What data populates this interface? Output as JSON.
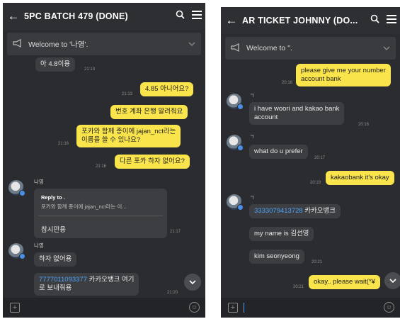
{
  "left": {
    "title": "5PC BATCH 479 (DONE)",
    "notice": "Welcome to '나영'.",
    "messages": {
      "m1": "아 4.8이용",
      "m1_time": "21:13",
      "m2": "4.85 아니어요?",
      "m2_time": "21:13",
      "m3": "번호 계좌 은행 알려줘요",
      "m4_line1": "포카와 함께 종이에 jajan_nct라는",
      "m4_line2": "이름을 쓸 수 있나요?",
      "m4_time": "21:16",
      "m5": "다른 포카 하자 없어요?",
      "m5_time": "21:16",
      "sender1": "나영",
      "reply_to": "Reply to .",
      "reply_quote": "포카와 함께 종이에 jajan_nct라는 이...",
      "reply_msg": "참시만용",
      "reply_time": "21:17",
      "sender2": "나영",
      "m6": "하자 없어용",
      "m7_account": "7777011093377",
      "m7_rest": " 카카오뱅크 여기",
      "m7_line2": "로 보내줘용",
      "m7_time": "21:20"
    }
  },
  "right": {
    "title": "AR TICKET JOHNNY (DO...",
    "notice": "Welcome to ''.",
    "messages": {
      "m1_line1": "please give me your number",
      "m1_line2": "account bank",
      "m1_time": "20:16",
      "sender1": "\"!",
      "m2_line1": "i have woori and kakao bank",
      "m2_line2": "account",
      "m2_time": "20:16",
      "sender2": "\"!",
      "m3": "what do u prefer",
      "m3_time": "20:17",
      "m4": "kakaobank it's okay",
      "m4_time": "20:19",
      "sender3": "\"!",
      "m5_account": "3333079413728",
      "m5_rest": " 카카오뱅크",
      "m6": "my name is 김선영",
      "m7": "kim seonyeong",
      "m7_time": "20:21",
      "m8": "okay.. please wait(*¥",
      "m8_time": "20:21"
    }
  },
  "icons": {
    "back": "←",
    "search": "⌕",
    "menu": "☰",
    "speaker": "📢",
    "chevron_down": "⌄",
    "plus": "+",
    "emoji": "☺"
  },
  "colors": {
    "background": "#2b2c30",
    "my_bubble": "#fae44c",
    "their_bubble": "#3d3e42",
    "link": "#4fa3f7"
  }
}
